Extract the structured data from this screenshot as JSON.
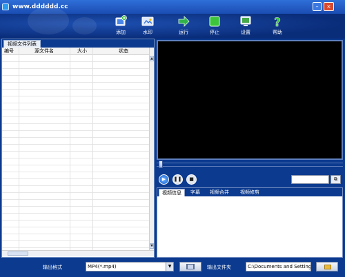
{
  "title": "www.dddddd.cc",
  "window_buttons": {
    "minimize": "–",
    "close": "×"
  },
  "toolbar": {
    "items": [
      {
        "label": "添加",
        "icon": "add-video-icon"
      },
      {
        "label": "水印",
        "icon": "watermark-icon"
      },
      {
        "label": "运行",
        "icon": "run-arrow-icon"
      },
      {
        "label": "停止",
        "icon": "stop-square-icon"
      },
      {
        "label": "设置",
        "icon": "settings-monitor-icon"
      },
      {
        "label": "帮助",
        "icon": "help-question-icon"
      }
    ]
  },
  "file_list": {
    "tab_label": "视频文件列表",
    "columns": [
      "编号",
      "源文件名",
      "大小",
      "状态"
    ],
    "rows": []
  },
  "player": {
    "controls": {
      "play": "play-icon",
      "pause": "pause-icon",
      "stop": "stop-icon"
    },
    "snapshot_icon": "copy-icon"
  },
  "info_tabs": [
    "视频信息",
    "字幕",
    "视频合并",
    "视频修剪"
  ],
  "bottom": {
    "format_label": "输出格式",
    "format_value": "MP4(*.mp4)",
    "folder_label": "输出文件夹",
    "folder_value": "C:\\Documents and Setting"
  },
  "colors": {
    "frame": "#0b3a8f",
    "accent": "#1a4db3",
    "stop_green": "#3cc43c",
    "run_arrow": "#32b34a"
  }
}
